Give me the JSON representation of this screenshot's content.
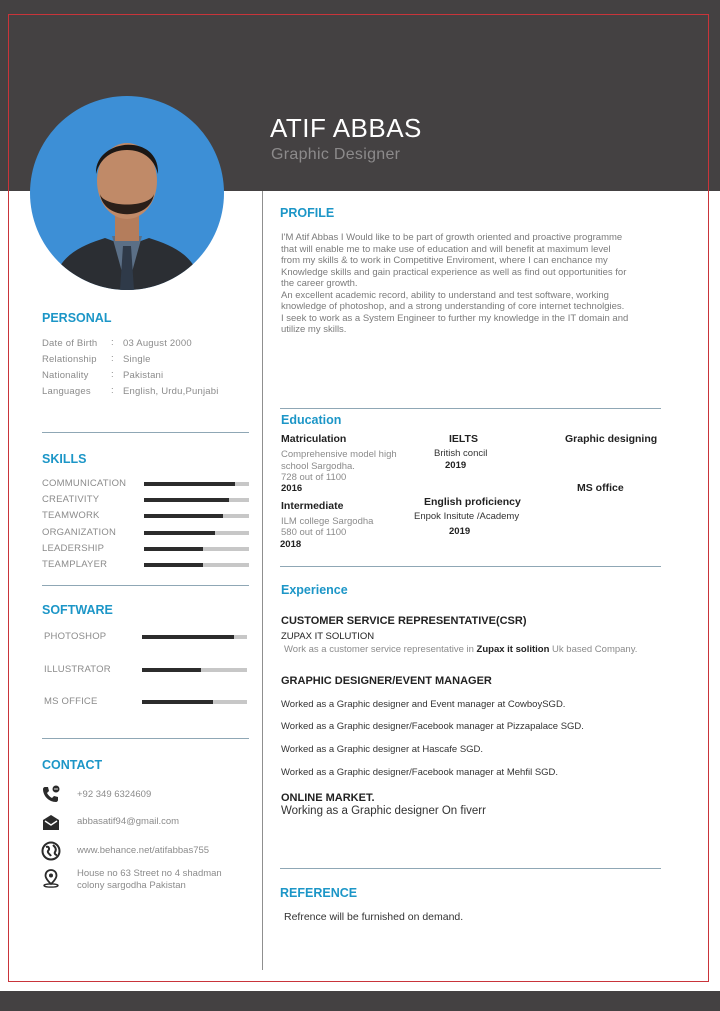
{
  "name": "ATIF ABBAS",
  "job_title": "Graphic Designer",
  "personal": {
    "heading": "PERSONAL",
    "rows": [
      {
        "label": "Date of Birth",
        "value": "03 August 2000"
      },
      {
        "label": "Relationship",
        "value": "Single"
      },
      {
        "label": "Nationality",
        "value": "Pakistani"
      },
      {
        "label": "Languages",
        "value": "English, Urdu,Punjabi"
      }
    ]
  },
  "skills": {
    "heading": "SKILLS",
    "items": [
      {
        "label": "COMMUNICATION",
        "level": 0.87
      },
      {
        "label": "CREATIVITY",
        "level": 0.81
      },
      {
        "label": "TEAMWORK",
        "level": 0.75
      },
      {
        "label": "ORGANIZATION",
        "level": 0.68
      },
      {
        "label": "LEADERSHIP",
        "level": 0.56
      },
      {
        "label": "TEAMPLAYER",
        "level": 0.56
      }
    ]
  },
  "software": {
    "heading": "SOFTWARE",
    "items": [
      {
        "label": "PHOTOSHOP",
        "level": 0.88
      },
      {
        "label": "ILLUSTRATOR",
        "level": 0.56
      },
      {
        "label": "MS OFFICE",
        "level": 0.68
      }
    ]
  },
  "contact": {
    "heading": "CONTACT",
    "phone": "+92 349 6324609",
    "email": "abbasatif94@gmail.com",
    "website": "www.behance.net/atifabbas755",
    "address_line1": "House no 63 Street no 4 shadman",
    "address_line2": "colony sargodha Pakistan"
  },
  "profile": {
    "heading": "PROFILE",
    "lines": [
      "I'M Atif Abbas I Would like to be part of growth oriented and proactive programme",
      "that will enable me to make use of education and will benefit at maximum level",
      "from my skills & to work in Competitive Enviroment, where I can enchance my",
      "Knowledge skills and gain practical experience as well as find out opportunities for",
      "the career growth.",
      "An excellent academic record, ability to understand and test software, working",
      "knowledge of photoshop, and a strong understanding of core internet technolgies.",
      "I seek to work as a System Engineer to further my knowledge in the IT domain and",
      "utilize my skills."
    ]
  },
  "education": {
    "heading": "Education",
    "matric_title": "Matriculation",
    "matric_line1": "Comprehensive model high",
    "matric_line2": "school Sargodha.",
    "matric_marks": "728 out of 1100",
    "matric_year": "2016",
    "ielts_title": "IELTS",
    "ielts_org": "British concil",
    "ielts_year": "2019",
    "graphic_title": "Graphic designing",
    "msoffice_title": "MS office",
    "inter_title": "Intermediate",
    "inter_line1": "ILM college Sargodha",
    "inter_marks": "580 out of 1100",
    "inter_year": "2018",
    "english_title": "English proficiency",
    "english_org": "Enpok Insitute /Academy",
    "english_year": "2019"
  },
  "experience": {
    "heading": "Experience",
    "csr_title": "CUSTOMER SERVICE REPRESENTATIVE(CSR)",
    "csr_company": "ZUPAX IT SOLUTION",
    "csr_desc_pre": "Work as a customer service representative in ",
    "csr_desc_bold": "Zupax it solition",
    "csr_desc_post": " Uk based Company.",
    "gd_title": "GRAPHIC DESIGNER/EVENT MANAGER",
    "gd_items": [
      "Worked as a Graphic designer and Event manager at CowboySGD.",
      "Worked as  a Graphic designer/Facebook manager at Pizzapalace SGD.",
      "Worked as a Graphic designer at Hascafe SGD.",
      "Worked as a Graphic designer/Facebook manager at Mehfil SGD."
    ],
    "online_title": "ONLINE MARKET.",
    "online_desc": "Working as a Graphic designer On fiverr"
  },
  "reference": {
    "heading": "REFERENCE",
    "text": "Refrence will be furnished on demand."
  },
  "colors": {
    "header_bg": "#444142",
    "accent": "#1c96c7",
    "photo_bg": "#3d8fd6",
    "frame": "#c9343a"
  }
}
